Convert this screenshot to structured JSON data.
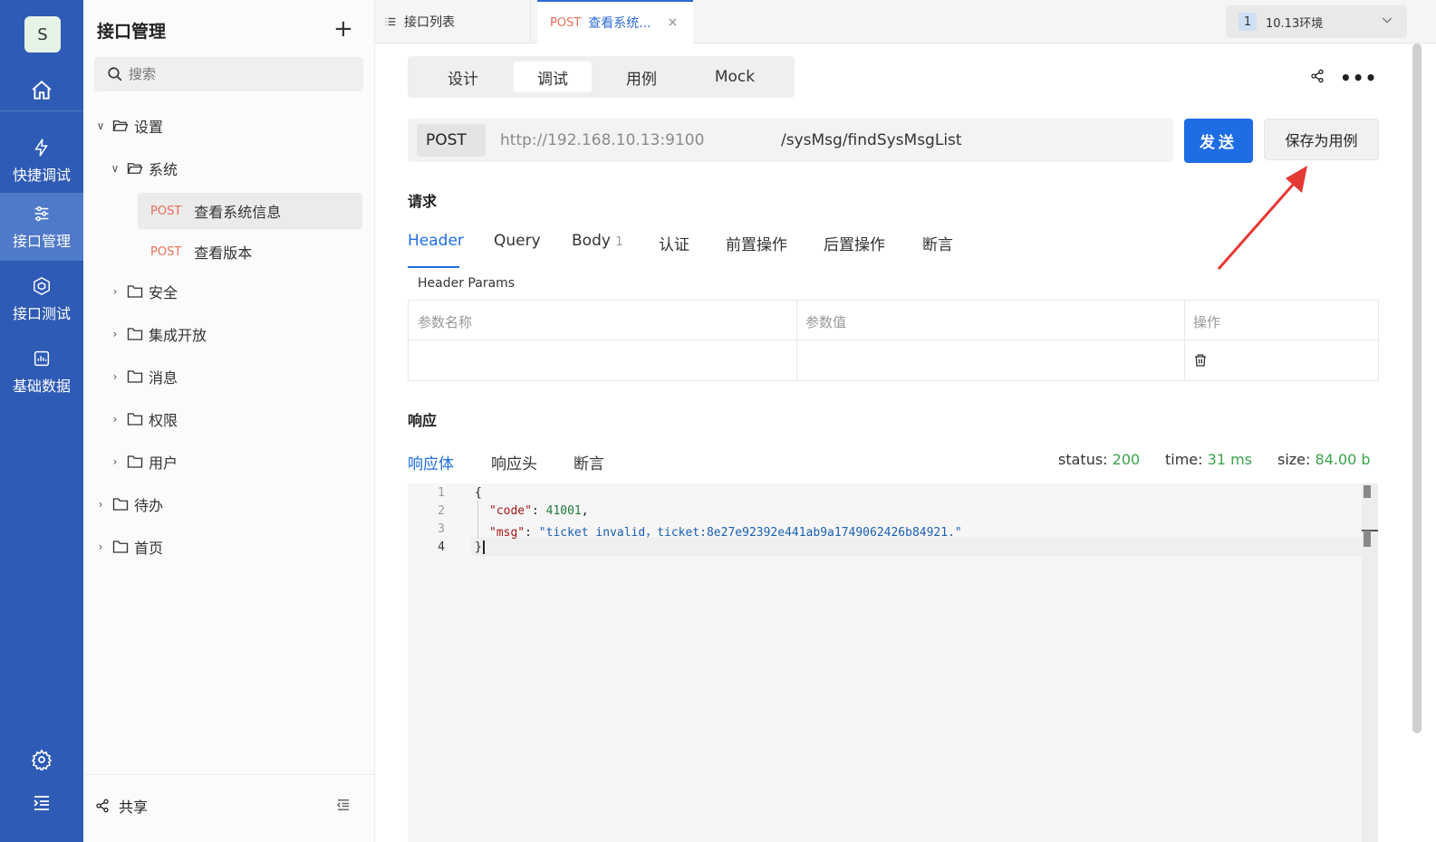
{
  "rail": {
    "avatar": "S",
    "items": [
      {
        "label": "快捷调试",
        "icon": "lightning-icon"
      },
      {
        "label": "接口管理",
        "icon": "sliders-icon"
      },
      {
        "label": "接口测试",
        "icon": "cube-icon"
      },
      {
        "label": "基础数据",
        "icon": "chart-icon"
      }
    ]
  },
  "sidebar": {
    "title": "接口管理",
    "search_placeholder": "搜索",
    "tree": [
      {
        "label": "设置"
      },
      {
        "label": "系统"
      },
      {
        "method": "POST",
        "label": "查看系统信息"
      },
      {
        "method": "POST",
        "label": "查看版本"
      },
      {
        "label": "安全"
      },
      {
        "label": "集成开放"
      },
      {
        "label": "消息"
      },
      {
        "label": "权限"
      },
      {
        "label": "用户"
      },
      {
        "label": "待办"
      },
      {
        "label": "首页"
      }
    ],
    "footer_share": "共享"
  },
  "tabs": {
    "list_label": "接口列表",
    "active_method": "POST",
    "active_name": "查看系统...",
    "close": "×"
  },
  "env": {
    "badge": "1",
    "name": "10.13环境"
  },
  "mode_tabs": [
    "设计",
    "调试",
    "用例",
    "Mock"
  ],
  "request": {
    "method": "POST",
    "host": "http://192.168.10.13:9100",
    "path": "/sysMsg/findSysMsgList",
    "send_label": "发送",
    "save_label": "保存为用例"
  },
  "req_section": {
    "title": "请求",
    "tabs": [
      "Header",
      "Query",
      "Body",
      "认证",
      "前置操作",
      "后置操作",
      "断言"
    ],
    "body_count": "1",
    "params_title": "Header Params",
    "columns": [
      "参数名称",
      "参数值",
      "操作"
    ]
  },
  "resp_section": {
    "title": "响应",
    "tabs": [
      "响应体",
      "响应头",
      "断言"
    ],
    "status_label": "status:",
    "status_value": "200",
    "time_label": "time:",
    "time_value": "31 ms",
    "size_label": "size:",
    "size_value": "84.00 b"
  },
  "response_body": {
    "line_numbers": [
      "1",
      "2",
      "3",
      "4"
    ],
    "lines": [
      "{",
      "\"code\": 41001,",
      "\"msg\": \"ticket invalid，ticket:8e27e92392e441ab9a1749062426b84921.\"",
      "}"
    ],
    "code_key": "\"code\"",
    "code_value": "41001",
    "msg_key": "\"msg\"",
    "msg_value": "\"ticket invalid，ticket:8e27e92392e441ab9a1749062426b84921.\""
  },
  "colors": {
    "primary": "#1e6de5",
    "rail": "#2e5bb5",
    "method": "#e8705a",
    "ok": "#3aa34b"
  }
}
